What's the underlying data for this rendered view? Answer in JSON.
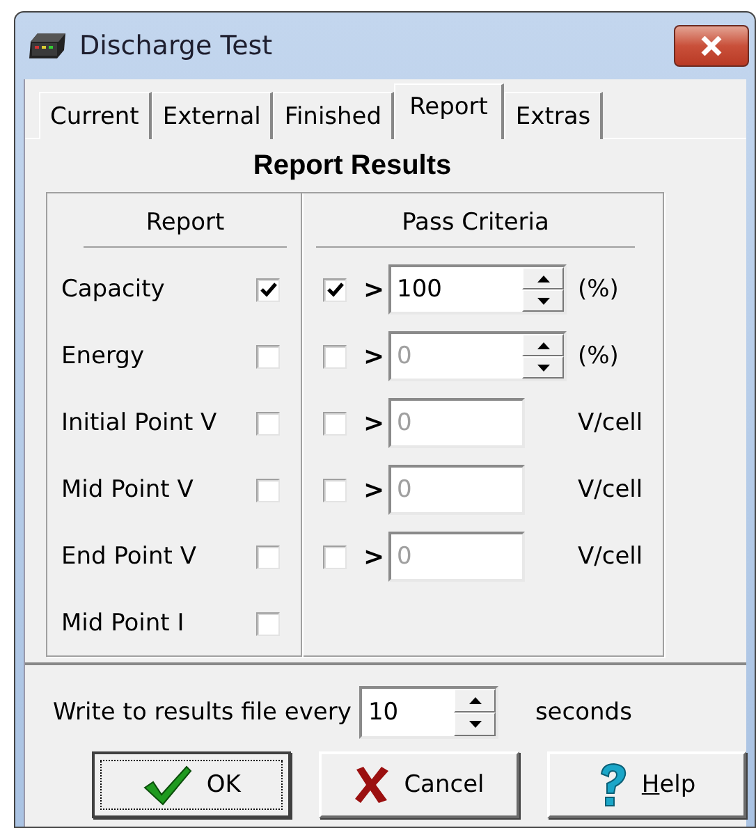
{
  "window": {
    "title": "Discharge Test"
  },
  "tabs": [
    {
      "label": "Current",
      "selected": false
    },
    {
      "label": "External",
      "selected": false
    },
    {
      "label": "Finished",
      "selected": false
    },
    {
      "label": "Report",
      "selected": true
    },
    {
      "label": "Extras",
      "selected": false
    }
  ],
  "report_results": {
    "title": "Report Results",
    "column_headers": [
      "Report",
      "Pass Criteria"
    ],
    "rows": [
      {
        "name": "Capacity",
        "checked": true,
        "criterion": {
          "checked": true,
          "operator": ">",
          "kind": "spin",
          "value": "100",
          "disabled": false,
          "unit": "(%)"
        }
      },
      {
        "name": "Energy",
        "checked": false,
        "criterion": {
          "checked": false,
          "operator": ">",
          "kind": "spin",
          "value": "0",
          "disabled": true,
          "unit": "(%)"
        }
      },
      {
        "name": "Initial Point V",
        "checked": false,
        "criterion": {
          "checked": false,
          "operator": ">",
          "kind": "plain",
          "value": "0",
          "disabled": true,
          "unit": "V/cell"
        }
      },
      {
        "name": "Mid Point V",
        "checked": false,
        "criterion": {
          "checked": false,
          "operator": ">",
          "kind": "plain",
          "value": "0",
          "disabled": true,
          "unit": "V/cell"
        }
      },
      {
        "name": "End Point V",
        "checked": false,
        "criterion": {
          "checked": false,
          "operator": ">",
          "kind": "plain",
          "value": "0",
          "disabled": true,
          "unit": "V/cell"
        }
      },
      {
        "name": "Mid Point I",
        "checked": false
      }
    ]
  },
  "write_interval": {
    "label": "Write to results file every",
    "value": "10",
    "unit": "seconds"
  },
  "buttons": [
    {
      "kind": "ok",
      "label": "OK",
      "focused": true
    },
    {
      "kind": "cancel",
      "label": "Cancel",
      "focused": false
    },
    {
      "kind": "help",
      "label": "Help",
      "focused": false,
      "mnemonic": true
    }
  ]
}
